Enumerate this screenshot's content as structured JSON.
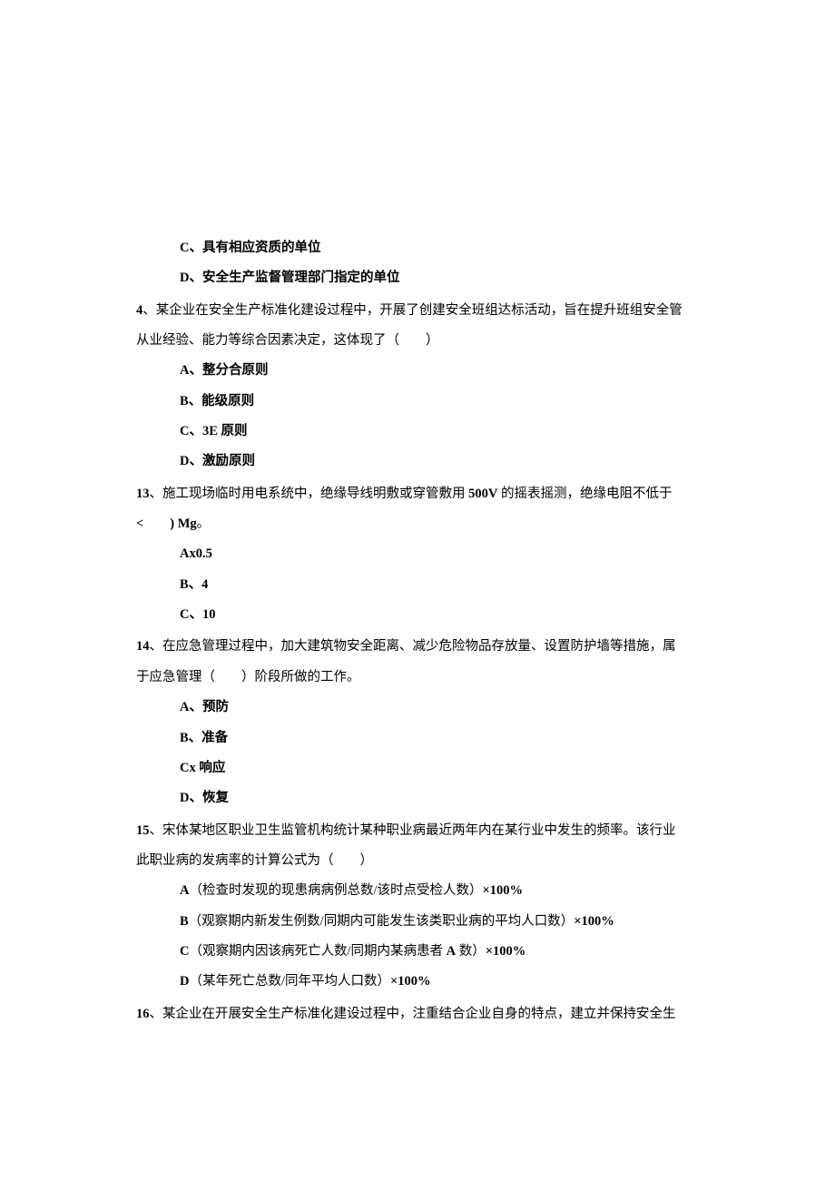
{
  "q3": {
    "optC": "C、具有相应资质的单位",
    "optD": "D、安全生产监督管理部门指定的单位"
  },
  "q4": {
    "prefix": "4",
    "stem1": "、某企业在安全生产标准化建设过程中，开展了创建安全班组达标活动，旨在提升班组安全管",
    "stem2": "从业经验、能力等综合因素决定，这体现了（　　）",
    "optA": "A、整分合原则",
    "optB": "B、能级原则",
    "optC_pre": "C、",
    "optC_bold": "3E",
    "optC_post": " 原则",
    "optD": "D、激励原则"
  },
  "q13": {
    "prefix": "13",
    "stem1a": "、施工现场临时用电系统中，绝缘导线明敷或穿管敷用 ",
    "stem1b": "500V",
    "stem1c": " 的摇表摇测，绝缘电阻不低于",
    "stem2a": "<　　) Mg",
    "stem2b": "。",
    "optA": "Ax0.5",
    "optB": "B、4",
    "optC": "C、10"
  },
  "q14": {
    "prefix": "14",
    "stem1": "、在应急管理过程中，加大建筑物安全距离、减少危险物品存放量、设置防护墙等措施，属",
    "stem2": "于应急管理（　　）阶段所做的工作。",
    "optA": "A、预防",
    "optB": "B、准备",
    "optC": "Cx 响应",
    "optD": "D、恢复"
  },
  "q15": {
    "prefix": "15",
    "stem1": "、宋体某地区职业卫生监管机构统计某种职业病最近两年内在某行业中发生的频率。该行业",
    "stem2": "此职业病的发病率的计算公式为（　　）",
    "optA_pre": "A",
    "optA_mid": "（检查时发现的现患病病例总数/该时点受检人数）",
    "optA_bold": "×100%",
    "optB_pre": "B",
    "optB_mid": "（观察期内新发生例数/同期内可能发生该类职业病的平均人口数）",
    "optB_bold": "×100%",
    "optC_pre": "C",
    "optC_mid1": "（观察期内因该病死亡人数/同期内某病患者 ",
    "optC_midA": "A",
    "optC_mid2": " 数）",
    "optC_bold": "×100%",
    "optD_pre": "D",
    "optD_mid": "（某年死亡总数/同年平均人口数）",
    "optD_bold": "×100%"
  },
  "q16": {
    "prefix": "16",
    "stem1": "、某企业在开展安全生产标准化建设过程中，注重结合企业自身的特点，建立并保持安全生"
  }
}
